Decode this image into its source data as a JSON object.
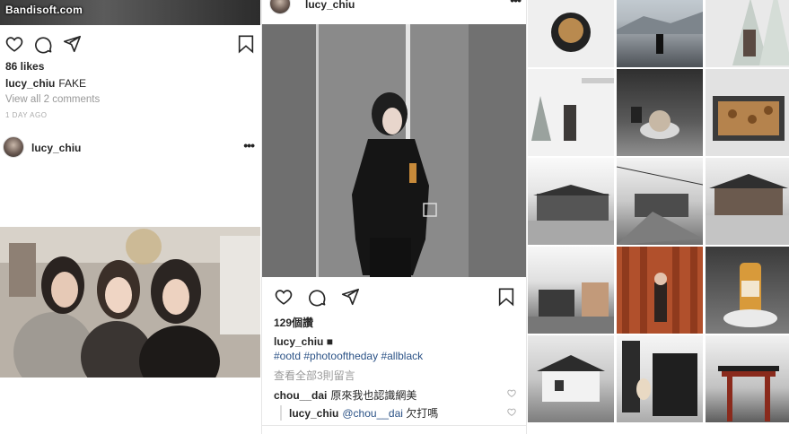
{
  "watermark": "Bandisoft.com",
  "left_post": {
    "likes": "86 likes",
    "caption_user": "lucy_chiu",
    "caption_text": "FAKE",
    "view_all": "View all 2 comments",
    "time": "1 DAY AGO"
  },
  "left_next_post": {
    "username": "lucy_chiu"
  },
  "center_post": {
    "username": "lucy_chiu",
    "likes": "129個讚",
    "caption_user": "lucy_chiu",
    "caption_text": "■",
    "hashtags": "#ootd #photooftheday #allblack",
    "view_all": "查看全部3則留言",
    "comments": [
      {
        "user": "chou__dai",
        "text": "原來我也認識網美"
      },
      {
        "user": "lucy_chiu",
        "mention": "@chou__dai",
        "text": "欠打嗎"
      }
    ]
  },
  "icons": {
    "like": "heart-icon",
    "comment": "comment-icon",
    "share": "share-icon",
    "save": "bookmark-icon",
    "more": "more-icon"
  },
  "colors": {
    "hashtag": "#2b5286",
    "muted": "#999999",
    "text": "#262626"
  }
}
